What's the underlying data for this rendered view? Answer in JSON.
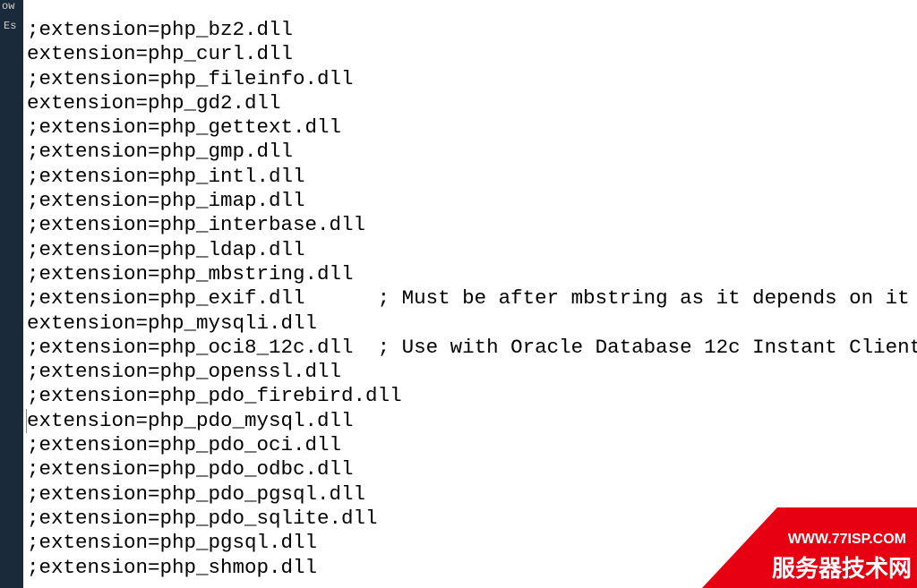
{
  "sidebar": {
    "text1": "ow",
    "text2": "Es"
  },
  "lines": [
    ";extension=php_bz2.dll",
    "extension=php_curl.dll",
    ";extension=php_fileinfo.dll",
    "extension=php_gd2.dll",
    ";extension=php_gettext.dll",
    ";extension=php_gmp.dll",
    ";extension=php_intl.dll",
    ";extension=php_imap.dll",
    ";extension=php_interbase.dll",
    ";extension=php_ldap.dll",
    ";extension=php_mbstring.dll",
    ";extension=php_exif.dll      ; Must be after mbstring as it depends on it",
    "extension=php_mysqli.dll",
    ";extension=php_oci8_12c.dll  ; Use with Oracle Database 12c Instant Client",
    ";extension=php_openssl.dll",
    ";extension=php_pdo_firebird.dll",
    "extension=php_pdo_mysql.dll",
    ";extension=php_pdo_oci.dll",
    ";extension=php_pdo_odbc.dll",
    ";extension=php_pdo_pgsql.dll",
    ";extension=php_pdo_sqlite.dll",
    ";extension=php_pgsql.dll",
    ";extension=php_shmop.dll"
  ],
  "cursor_line_index": 16,
  "watermark": {
    "url": "WWW.77ISP.COM",
    "title": "服务器技术网"
  }
}
